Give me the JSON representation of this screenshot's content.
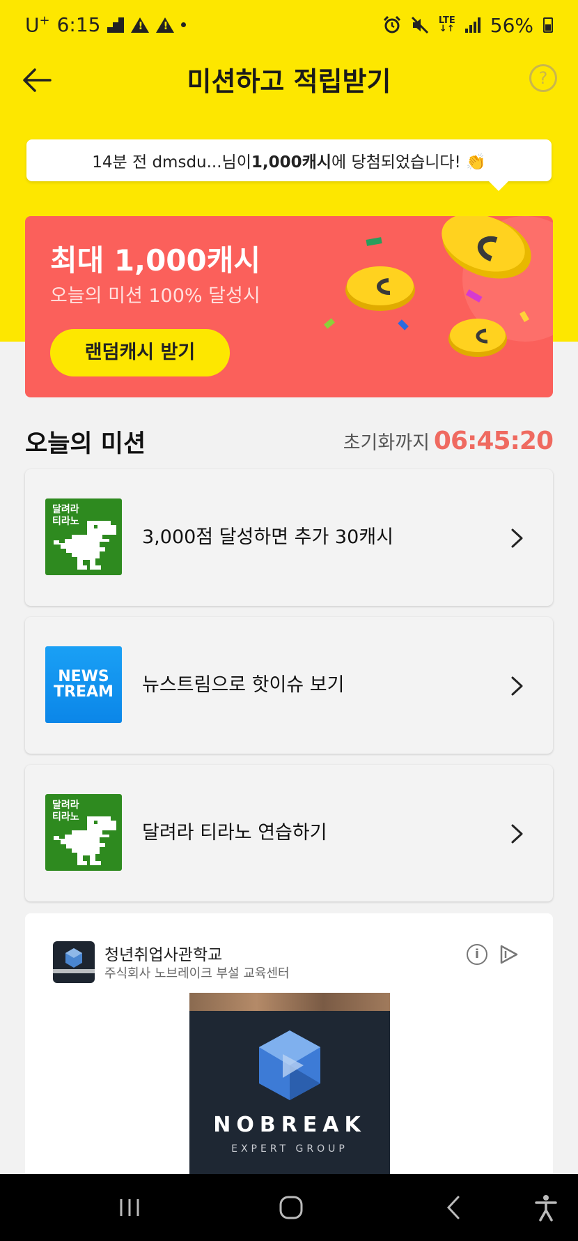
{
  "status_bar": {
    "carrier": "U",
    "carrier_sup": "+",
    "time": "6:15",
    "battery": "56%",
    "network": "LTE"
  },
  "header": {
    "title": "미션하고 적립받기",
    "help": "?"
  },
  "notice": {
    "prefix": "14분 전 dmsdu...님이 ",
    "amount": "1,000캐시",
    "suffix": "에 당첨되었습니다! 👏"
  },
  "promo": {
    "title": "최대 1,000캐시",
    "subtitle": "오늘의 미션 100% 달성시",
    "button": "랜덤캐시 받기"
  },
  "missions_section": {
    "title": "오늘의 미션",
    "reset_label": "초기화까지",
    "reset_timer": "06:45:20"
  },
  "missions": [
    {
      "label": "3,000점 달성하면 추가 30캐시",
      "thumb": "달려라\n티라노"
    },
    {
      "label": "뉴스트림으로 핫이슈 보기",
      "thumb": "NEWS TREAM"
    },
    {
      "label": "달려라 티라노 연습하기",
      "thumb": "달려라\n티라노"
    }
  ],
  "ad": {
    "name": "청년취업사관학교",
    "org": "주식회사 노브레이크 부설 교육센터",
    "info": "i",
    "brand": "NOBREAK",
    "tagline": "EXPERT GROUP"
  },
  "colors": {
    "brand_yellow": "#fde700",
    "promo_red": "#fb605b",
    "timer_red": "#ef6a60",
    "dino_green": "#2e8a1f",
    "news_blue": "#0b86e8"
  }
}
